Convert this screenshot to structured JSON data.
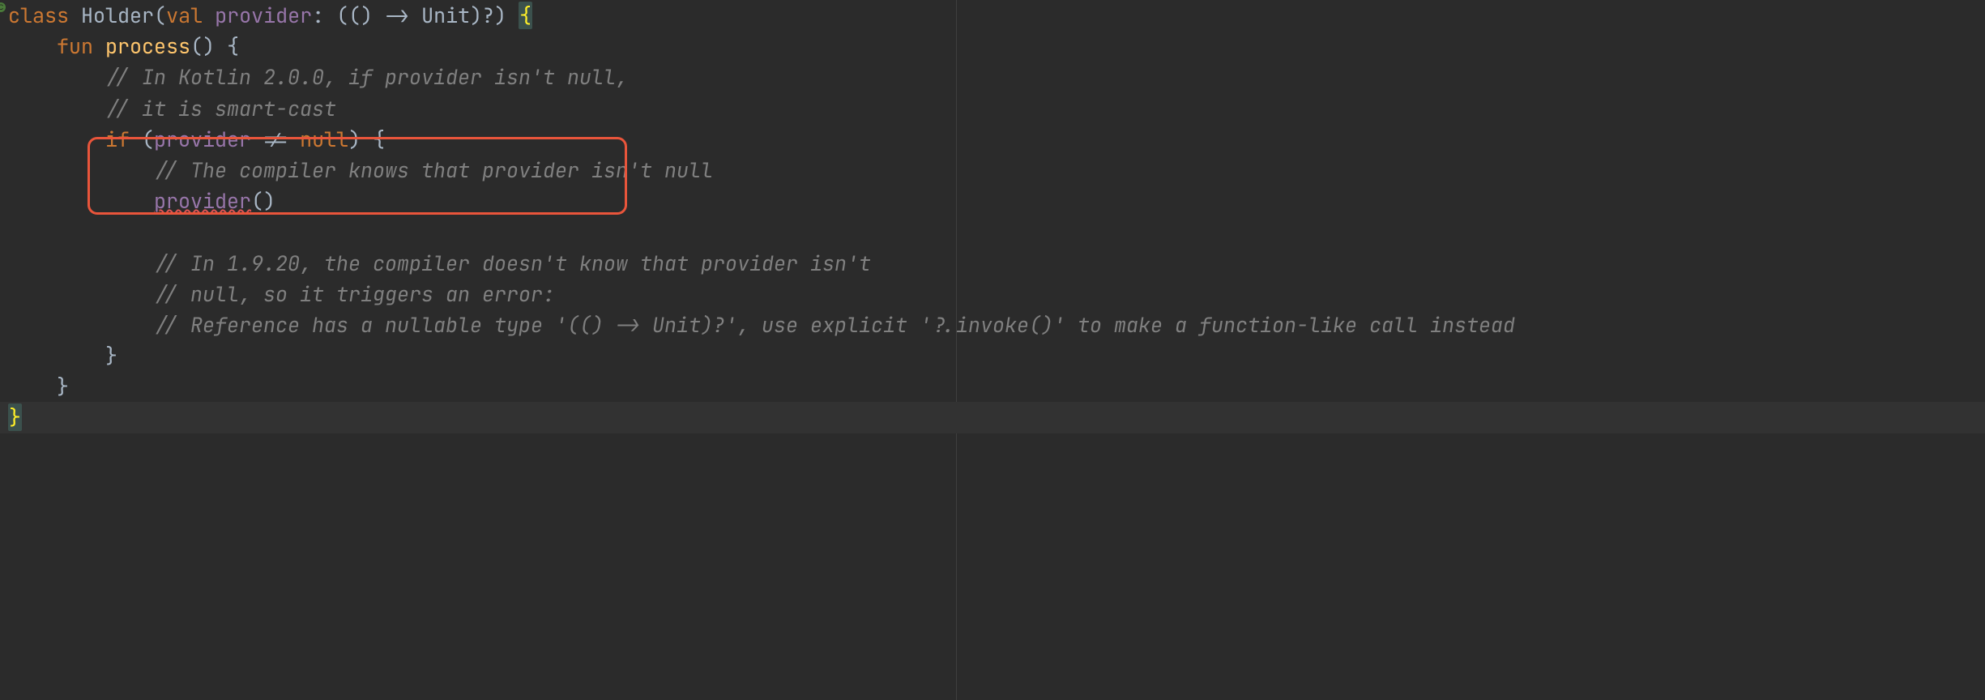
{
  "code": {
    "line1": {
      "kw_class": "class",
      "class_name": "Holder",
      "paren_open": "(",
      "kw_val": "val",
      "prop_name": "provider",
      "type_colon": ": (() -> Unit)?) ",
      "brace_open": "{"
    },
    "line2": {
      "indent": "    ",
      "kw_fun": "fun",
      "fn_name": "process",
      "rest": "() {"
    },
    "line3": {
      "indent": "        ",
      "comment": "// In Kotlin 2.0.0, if provider isn't null,"
    },
    "line4": {
      "indent": "        ",
      "comment": "// it is smart-cast"
    },
    "line5": {
      "indent": "        ",
      "kw_if": "if",
      "paren": " (",
      "prop": "provider",
      "neq": " != ",
      "null": "null",
      "close": ") {"
    },
    "line6": {
      "indent": "            ",
      "comment": "// The compiler knows that provider isn't null"
    },
    "line7": {
      "indent": "            ",
      "call": "provider",
      "tail": "()"
    },
    "line8": {
      "blank": ""
    },
    "line9": {
      "indent": "            ",
      "comment": "// In 1.9.20, the compiler doesn't know that provider isn't"
    },
    "line10": {
      "indent": "            ",
      "comment": "// null, so it triggers an error:"
    },
    "line11": {
      "indent": "            ",
      "comment": "// Reference has a nullable type '(() -> Unit)?', use explicit '?.invoke()' to make a function-like call instead"
    },
    "line12": {
      "indent": "        ",
      "brace": "}"
    },
    "line13": {
      "indent": "    ",
      "brace": "}"
    },
    "line14": {
      "brace": "}"
    }
  },
  "annotation": {
    "box_label": "smart-cast-highlight"
  }
}
